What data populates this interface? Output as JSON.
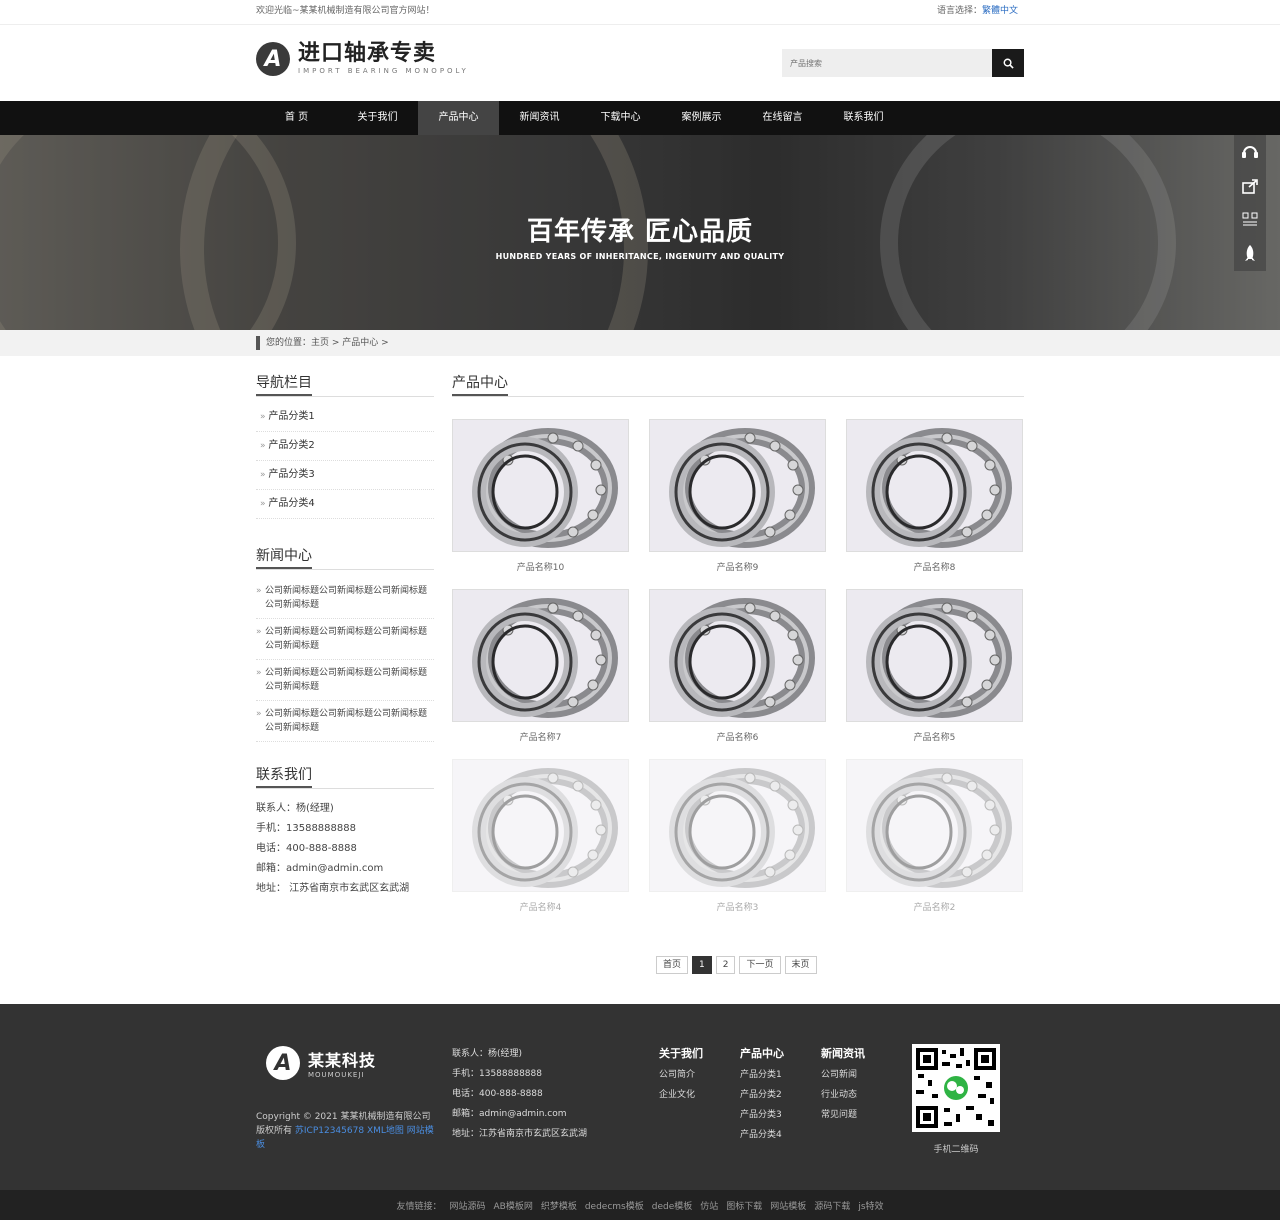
{
  "topbar": {
    "welcome": "欢迎光临~某某机械制造有限公司官方网站！",
    "lang_label": "语言选择：",
    "lang_trad": "繁體",
    "lang_cn": "中文"
  },
  "header": {
    "logo_mark": "A",
    "logo_title": "进口轴承专卖",
    "logo_sub": "IMPORT BEARING MONOPOLY",
    "search_placeholder": "产品搜索"
  },
  "nav": {
    "items": [
      "首 页",
      "关于我们",
      "产品中心",
      "新闻资讯",
      "下载中心",
      "案例展示",
      "在线留言",
      "联系我们"
    ],
    "active": 2
  },
  "banner": {
    "title": "百年传承 匠心品质",
    "subtitle": "HUNDRED YEARS OF INHERITANCE, INGENUITY AND QUALITY"
  },
  "float": {
    "icons": [
      "headset-icon",
      "share-icon",
      "qrcode-icon",
      "rocket-icon"
    ]
  },
  "breadcrumb": {
    "text": "您的位置：主页 > 产品中心 >"
  },
  "sidebar": {
    "nav_title": "导航栏目",
    "categories": [
      "产品分类1",
      "产品分类2",
      "产品分类3",
      "产品分类4"
    ],
    "news_title": "新闻中心",
    "news": [
      "公司新闻标题公司新闻标题公司新闻标题公司新闻标题",
      "公司新闻标题公司新闻标题公司新闻标题公司新闻标题",
      "公司新闻标题公司新闻标题公司新闻标题公司新闻标题",
      "公司新闻标题公司新闻标题公司新闻标题公司新闻标题"
    ],
    "contact_title": "联系我们",
    "contact": [
      "联系人：杨(经理)",
      "手机：13588888888",
      "电话：400-888-8888",
      "邮箱：admin@admin.com",
      "地址： 江苏省南京市玄武区玄武湖"
    ]
  },
  "content": {
    "title": "产品中心",
    "products": [
      "产品名称10",
      "产品名称9",
      "产品名称8",
      "产品名称7",
      "产品名称6",
      "产品名称5",
      "产品名称4",
      "产品名称3",
      "产品名称2"
    ]
  },
  "pager": {
    "first": "首页",
    "pages": [
      "1",
      "2"
    ],
    "current": "1",
    "next": "下一页",
    "last": "末页"
  },
  "footer": {
    "logo_title": "某某科技",
    "logo_sub": "MOUMOUKEJI",
    "copyright": "Copyright © 2021 某某机械制造有限公司 版权所有 ",
    "icp": "苏ICP12345678",
    "xml": "XML地图",
    "tpl": "网站模板",
    "contact": [
      "联系人：杨(经理)",
      "手机：13588888888",
      "电话：400-888-8888",
      "邮箱：admin@admin.com",
      "地址：江苏省南京市玄武区玄武湖"
    ],
    "cols": [
      {
        "title": "关于我们",
        "items": [
          "公司简介",
          "企业文化"
        ]
      },
      {
        "title": "产品中心",
        "items": [
          "产品分类1",
          "产品分类2",
          "产品分类3",
          "产品分类4"
        ]
      },
      {
        "title": "新闻资讯",
        "items": [
          "公司新闻",
          "行业动态",
          "常见问题"
        ]
      }
    ],
    "qr_label": "手机二维码"
  },
  "links": {
    "label": "友情链接：",
    "items": [
      "网站源码",
      "AB模板网",
      "织梦模板",
      "dedecms模板",
      "dede模板",
      "仿站",
      "图标下载",
      "网站模板",
      "源码下载",
      "js特效"
    ]
  },
  "colors": {
    "nav_bg": "#111111",
    "nav_active": "#444444",
    "footer_bg": "#333333",
    "link_blue": "#2a6cc2"
  }
}
